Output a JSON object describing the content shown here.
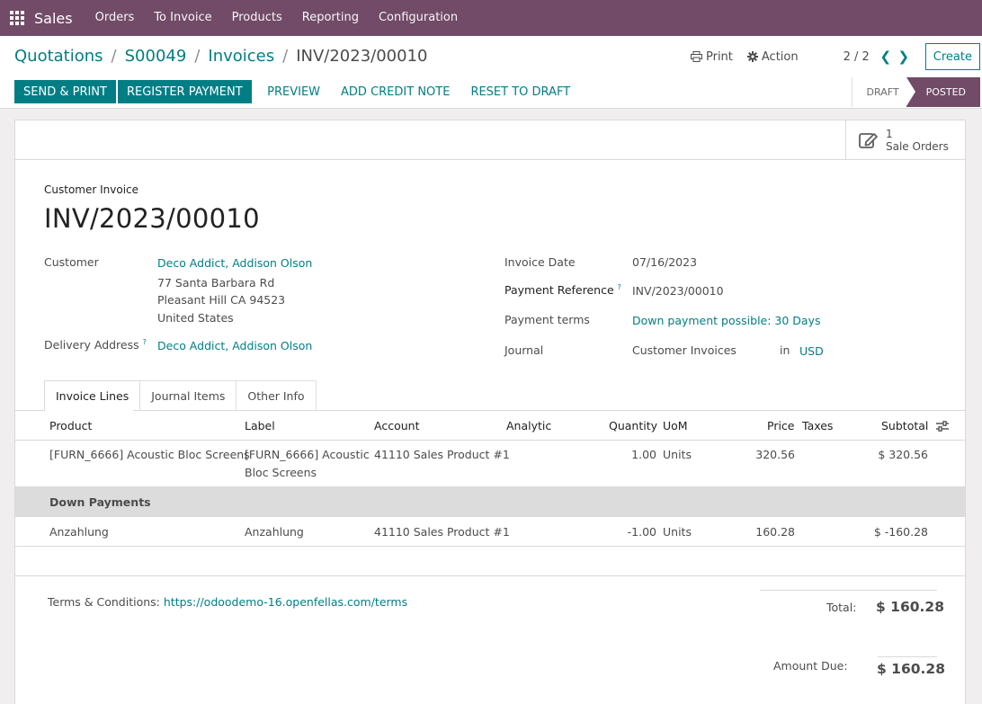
{
  "navbar": {
    "app_name": "Sales",
    "menu": [
      "Orders",
      "To Invoice",
      "Products",
      "Reporting",
      "Configuration"
    ]
  },
  "breadcrumb": {
    "items": [
      "Quotations",
      "S00049",
      "Invoices"
    ],
    "current": "INV/2023/00010"
  },
  "control": {
    "print_label": "Print",
    "action_label": "Action",
    "pager": "2 / 2",
    "create_label": "Create"
  },
  "actions": {
    "send_print": "SEND & PRINT",
    "register_payment": "REGISTER PAYMENT",
    "preview": "PREVIEW",
    "add_credit_note": "ADD CREDIT NOTE",
    "reset_to_draft": "RESET TO DRAFT"
  },
  "statusbar": {
    "draft": "DRAFT",
    "posted": "POSTED",
    "active": "POSTED"
  },
  "smart_button": {
    "count": "1",
    "label": "Sale Orders"
  },
  "invoice": {
    "type": "Customer Invoice",
    "name": "INV/2023/00010",
    "customer_label": "Customer",
    "customer": "Deco Addict, Addison Olson",
    "address_line1": "77 Santa Barbara Rd",
    "address_line2": "Pleasant Hill CA 94523",
    "address_line3": "United States",
    "delivery_label": "Delivery Address",
    "delivery": "Deco Addict, Addison Olson",
    "invoice_date_label": "Invoice Date",
    "invoice_date": "07/16/2023",
    "payment_ref_label": "Payment Reference",
    "payment_ref": "INV/2023/00010",
    "payment_terms_label": "Payment terms",
    "payment_terms": "Down payment possible: 30 Days",
    "journal_label": "Journal",
    "journal": "Customer Invoices",
    "journal_in": "in",
    "currency": "USD",
    "help_mark": "?"
  },
  "tabs": [
    "Invoice Lines",
    "Journal Items",
    "Other Info"
  ],
  "lines": {
    "columns": [
      "Product",
      "Label",
      "Account",
      "Analytic",
      "Quantity",
      "UoM",
      "Price",
      "Taxes",
      "Subtotal"
    ],
    "row1": {
      "product": "[FURN_6666] Acoustic Bloc Screens",
      "label_l1": "[FURN_6666] Acoustic",
      "label_l2": "Bloc Screens",
      "account": "41110 Sales Product #1",
      "quantity": "1.00",
      "uom": "Units",
      "price": "320.56",
      "subtotal": "$ 320.56"
    },
    "section": "Down Payments",
    "row2": {
      "product": "Anzahlung",
      "label": "Anzahlung",
      "account": "41110 Sales Product #1",
      "quantity": "-1.00",
      "uom": "Units",
      "price": "160.28",
      "subtotal": "$ -160.28"
    }
  },
  "footer": {
    "terms_label": "Terms & Conditions:",
    "terms_link": "https://odoodemo-16.openfellas.com/terms",
    "total_label": "Total:",
    "total": "$ 160.28",
    "amount_due_label": "Amount Due:",
    "amount_due": "$ 160.28"
  }
}
